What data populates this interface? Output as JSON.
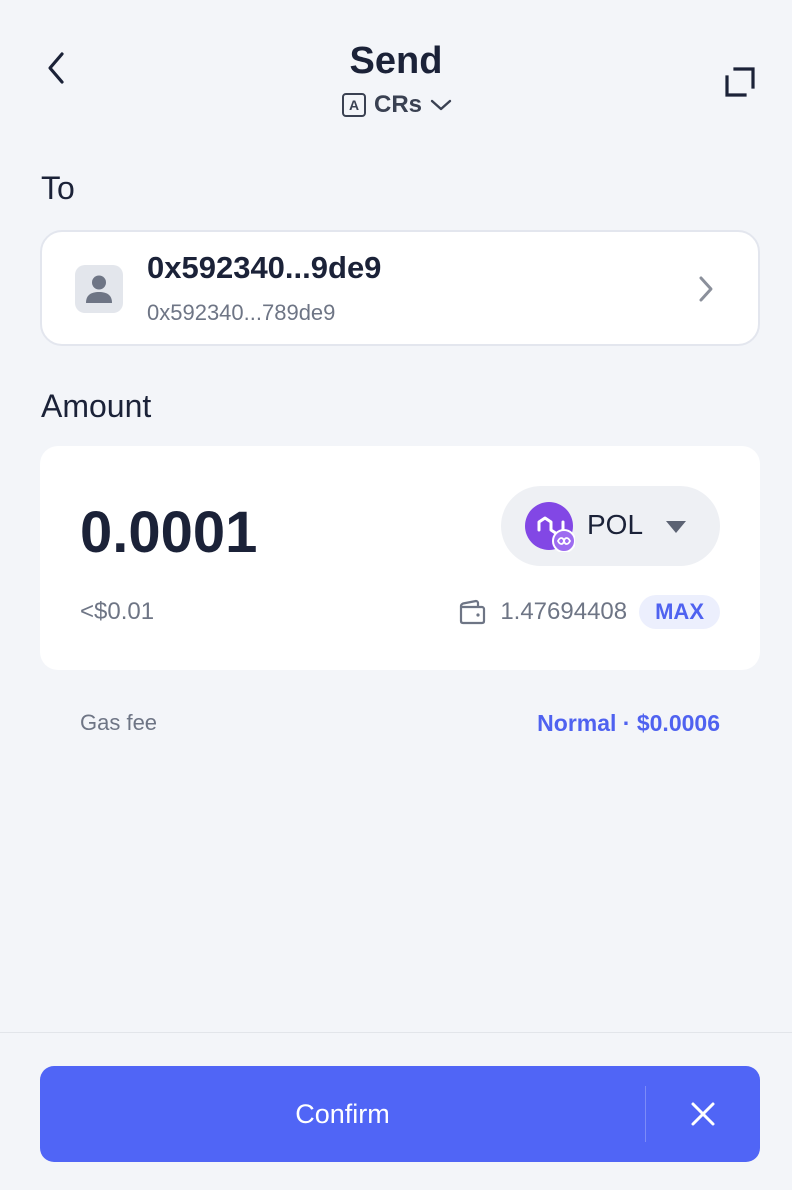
{
  "header": {
    "title": "Send",
    "account_badge": "A",
    "account_name": "CRs"
  },
  "icons": {
    "back": "chevron-left-icon",
    "expand": "expand-icon",
    "account_dropdown": "chevron-down-icon",
    "avatar": "user-icon",
    "recipient_arrow": "chevron-right-icon",
    "token": "polygon-icon",
    "token_caret": "caret-down-icon",
    "wallet": "wallet-icon",
    "close": "close-icon"
  },
  "recipient": {
    "label": "To",
    "name": "0x592340...9de9",
    "address": "0x592340...789de9"
  },
  "amount": {
    "label": "Amount",
    "value": "0.0001",
    "usd_value": "<$0.01",
    "token_symbol": "POL",
    "balance": "1.47694408",
    "max_label": "MAX"
  },
  "gas": {
    "label": "Gas fee",
    "value": "Normal · $0.0006"
  },
  "footer": {
    "confirm_label": "Confirm"
  },
  "colors": {
    "background": "#f3f5f9",
    "accent": "#5065f6",
    "token_purple": "#8247e5",
    "text_primary": "#1b2238",
    "text_secondary": "#6e7585"
  }
}
